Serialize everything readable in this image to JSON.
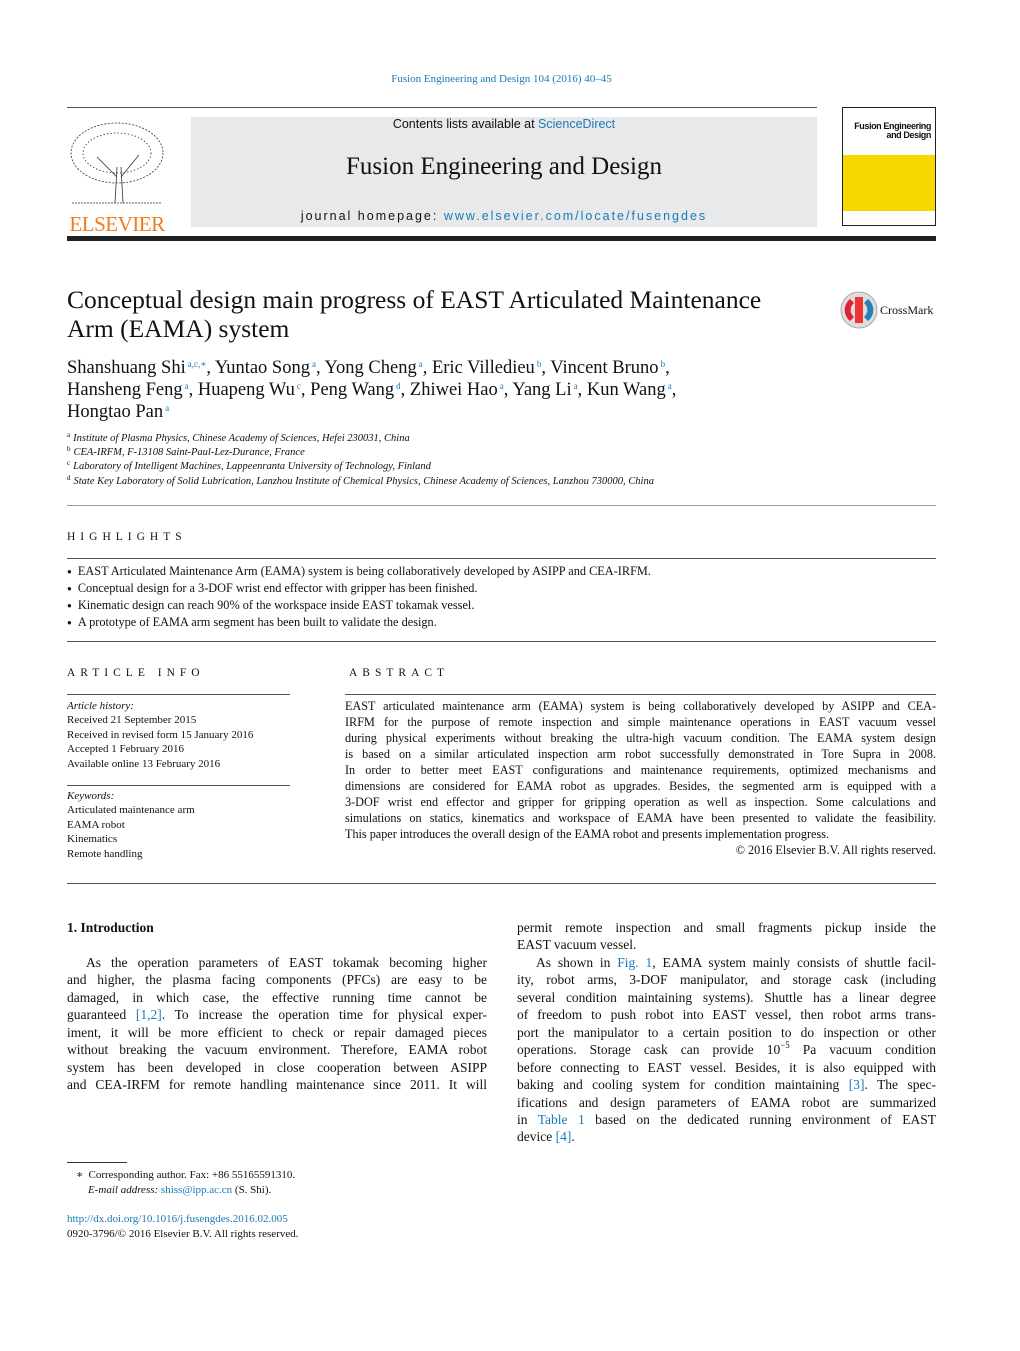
{
  "citation": "Fusion Engineering and Design 104 (2016) 40–45",
  "header": {
    "contents_prefix": "Contents lists available at ",
    "contents_link": "ScienceDirect",
    "journal": "Fusion Engineering and Design",
    "homepage_prefix": "journal homepage: ",
    "homepage_link": "www.elsevier.com/locate/fusengdes",
    "publisher": "ELSEVIER",
    "cover_title_1": "Fusion Engineering",
    "cover_title_2": "and Design",
    "crossmark": "CrossMark"
  },
  "title_lines": [
    "Conceptual design main progress of EAST Articulated Maintenance",
    "Arm (EAMA) system"
  ],
  "authors": [
    [
      {
        "n": "Shanshuang Shi",
        "s": "a,c,∗"
      },
      {
        "n": ", Yuntao Song",
        "s": "a"
      },
      {
        "n": ", Yong Cheng",
        "s": "a"
      },
      {
        "n": ", Eric Villedieu",
        "s": "b"
      },
      {
        "n": ", Vincent Bruno",
        "s": "b"
      },
      {
        "n": ",",
        "s": ""
      }
    ],
    [
      {
        "n": "Hansheng Feng",
        "s": "a"
      },
      {
        "n": ", Huapeng Wu",
        "s": "c"
      },
      {
        "n": ", Peng Wang",
        "s": "d"
      },
      {
        "n": ", Zhiwei Hao",
        "s": "a"
      },
      {
        "n": ", Yang Li",
        "s": "a"
      },
      {
        "n": ", Kun Wang",
        "s": "a"
      },
      {
        "n": ",",
        "s": ""
      }
    ],
    [
      {
        "n": "Hongtao Pan",
        "s": "a"
      }
    ]
  ],
  "affiliations": [
    {
      "k": "a",
      "t": "Institute of Plasma Physics, Chinese Academy of Sciences, Hefei 230031, China"
    },
    {
      "k": "b",
      "t": "CEA-IRFM, F-13108 Saint-Paul-Lez-Durance, France"
    },
    {
      "k": "c",
      "t": "Laboratory of Intelligent Machines, Lappeenranta University of Technology, Finland"
    },
    {
      "k": "d",
      "t": "State Key Laboratory of Solid Lubrication, Lanzhou Institute of Chemical Physics, Chinese Academy of Sciences, Lanzhou 730000, China"
    }
  ],
  "highlights": {
    "heading": "HIGHLIGHTS",
    "items": [
      "EAST Articulated Maintenance Arm (EAMA) system is being collaboratively developed by ASIPP and CEA-IRFM.",
      "Conceptual design for a 3-DOF wrist end effector with gripper has been finished.",
      "Kinematic design can reach 90% of the workspace inside EAST tokamak vessel.",
      "A prototype of EAMA arm segment has been built to validate the design."
    ]
  },
  "article_info": {
    "heading": "ARTICLE INFO",
    "history_label": "Article history:",
    "history": [
      "Received 21 September 2015",
      "Received in revised form 15 January 2016",
      "Accepted 1 February 2016",
      "Available online 13 February 2016"
    ],
    "keywords_label": "Keywords:",
    "keywords": [
      "Articulated maintenance arm",
      "EAMA robot",
      "Kinematics",
      "Remote handling"
    ]
  },
  "abstract": {
    "heading": "ABSTRACT",
    "lines": [
      "EAST articulated maintenance arm (EAMA) system is being collaboratively developed by ASIPP and CEA-",
      "IRFM for the purpose of remote inspection and simple maintenance operations in EAST vacuum vessel",
      "during physical experiments without breaking the ultra-high vacuum condition. The EAMA system design",
      "is based on a similar articulated inspection arm robot successfully demonstrated in Tore Supra in 2008.",
      "In order to better meet EAST configurations and maintenance requirements, optimized mechanisms and",
      "dimensions are considered for EAMA robot as upgrades. Besides, the segmented arm is equipped with a",
      "3-DOF wrist end effector and gripper for gripping operation as well as inspection. Some calculations and",
      "simulations on statics, kinematics and workspace of EAMA have been presented to validate the feasibility.",
      "This paper introduces the overall design of the EAMA robot and presents implementation progress."
    ],
    "copyright": "© 2016 Elsevier B.V. All rights reserved."
  },
  "intro": {
    "heading": "1.  Introduction",
    "left": [
      [
        {
          "t": "As the operation parameters of EAST tokamak becoming higher"
        }
      ],
      [
        {
          "t": "and higher, the plasma facing components (PFCs) are easy to be"
        }
      ],
      [
        {
          "t": "damaged, in which case, the effective running time cannot be"
        }
      ],
      [
        {
          "t": "guaranteed "
        },
        {
          "t": "[1,2]",
          "l": 1
        },
        {
          "t": ". To increase the operation time for physical exper-"
        }
      ],
      [
        {
          "t": "iment, it will be more efficient to check or repair damaged pieces"
        }
      ],
      [
        {
          "t": "without breaking the vacuum environment. Therefore, EAMA robot"
        }
      ],
      [
        {
          "t": "system has been developed in close cooperation between ASIPP"
        }
      ],
      [
        {
          "t": "and CEA-IRFM for remote handling maintenance since 2011. It will"
        }
      ]
    ],
    "right": [
      [
        {
          "t": "permit remote inspection and small fragments pickup inside the"
        }
      ],
      [
        {
          "t": "EAST vacuum vessel."
        }
      ],
      [
        {
          "t": "As shown in "
        },
        {
          "t": "Fig. 1",
          "l": 1
        },
        {
          "t": ", EAMA system mainly consists of shuttle facil-"
        }
      ],
      [
        {
          "t": "ity, robot arms, 3-DOF manipulator, and storage cask (including"
        }
      ],
      [
        {
          "t": "several condition maintaining systems). Shuttle has a linear degree"
        }
      ],
      [
        {
          "t": "of freedom to push robot into EAST vessel, then robot arms trans-"
        }
      ],
      [
        {
          "t": "port the manipulator to a certain position to do inspection or other"
        }
      ],
      [
        {
          "t": "operations. Storage cask can provide 10"
        },
        {
          "t": "−5",
          "sup": 1
        },
        {
          "t": " Pa vacuum condition"
        }
      ],
      [
        {
          "t": "before connecting to EAST vessel. Besides, it is also equipped with"
        }
      ],
      [
        {
          "t": "baking and cooling system for condition maintaining "
        },
        {
          "t": "[3]",
          "l": 1
        },
        {
          "t": ". The spec-"
        }
      ],
      [
        {
          "t": "ifications and design parameters of EAMA robot are summarized"
        }
      ],
      [
        {
          "t": "in "
        },
        {
          "t": "Table 1",
          "l": 1
        },
        {
          "t": " based on the dedicated running environment of EAST"
        }
      ],
      [
        {
          "t": "device "
        },
        {
          "t": "[4]",
          "l": 1
        },
        {
          "t": "."
        }
      ]
    ]
  },
  "footnote": {
    "mark": "∗",
    "text": "Corresponding author. Fax: +86 55165591310.",
    "email_label": "E-mail address: ",
    "email": "shiss@ipp.ac.cn",
    "email_suffix": " (S. Shi)."
  },
  "doi": "http://dx.doi.org/10.1016/j.fusengdes.2016.02.005",
  "issn": "0920-3796/© 2016 Elsevier B.V. All rights reserved.",
  "colors": {
    "link": "#1a7ab5",
    "elsevier_orange": "#f07c1b",
    "cover_yellow": "#f5d800",
    "banner_bg": "#e8e9ea"
  }
}
